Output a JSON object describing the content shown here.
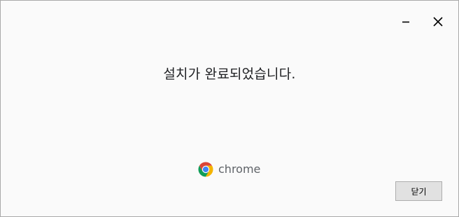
{
  "dialog": {
    "message": "설치가 완료되었습니다.",
    "brand_name": "chrome",
    "close_button_label": "닫기"
  },
  "icons": {
    "minimize": "minimize-icon",
    "close": "close-icon",
    "brand": "chrome-logo-icon"
  },
  "colors": {
    "background": "#fafafa",
    "text": "#202124",
    "brand_text": "#5f6368",
    "button_bg": "#e1e1e1",
    "button_border": "#adadad",
    "chrome_red": "#db4437",
    "chrome_yellow": "#f4b400",
    "chrome_green": "#0f9d58",
    "chrome_blue": "#4285f4"
  }
}
